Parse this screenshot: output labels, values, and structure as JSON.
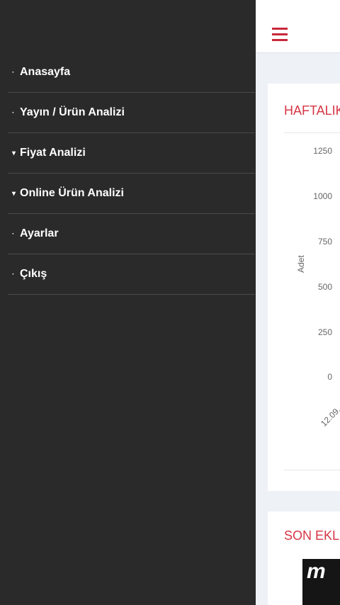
{
  "drawer": {
    "items": [
      {
        "label": "Anasayfa",
        "marker": "·"
      },
      {
        "label": "Yayın / Ürün Analizi",
        "marker": "·"
      },
      {
        "label": "Fiyat Analizi",
        "marker": "▾"
      },
      {
        "label": "Online Ürün Analizi",
        "marker": "▾"
      },
      {
        "label": "Ayarlar",
        "marker": "·"
      },
      {
        "label": "Çıkış",
        "marker": "·"
      }
    ]
  },
  "main": {
    "menu_icon": "hamburger-menu-icon",
    "weekly_card": {
      "title": "HAFTALIK",
      "y_axis_label": "Adet",
      "y_ticks": [
        "1250",
        "1000",
        "750",
        "500",
        "250",
        "0"
      ],
      "x_ticks": [
        "12.09."
      ]
    },
    "latest_card": {
      "title": "SON EKLE",
      "thumbnail_text": "m"
    }
  },
  "colors": {
    "drawer_bg": "#2a2a2a",
    "accent": "#d63645",
    "content_bg": "#eef1f5"
  }
}
